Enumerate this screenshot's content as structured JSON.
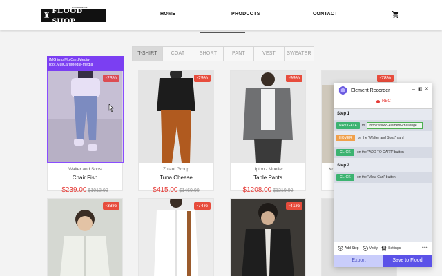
{
  "header": {
    "logo_tag": "ecommerce",
    "logo_text": "FLOOD SHOP",
    "nav": [
      "HOME",
      "PRODUCTS",
      "CONTACT"
    ],
    "cart_icon": "cart-icon"
  },
  "filters": {
    "tabs": [
      "T-SHIRT",
      "COAT",
      "SHORT",
      "PANT",
      "VEST",
      "SWEATER"
    ],
    "active": "T-SHIRT"
  },
  "overlay": {
    "label": "IMG img.MuiCardMedia-root.MuiCardMedia-media"
  },
  "products": [
    {
      "badge": "-23%",
      "vendor": "Walter and Sons",
      "title": "Chair Fish",
      "price": "$239.00",
      "old_price": "$1018.00"
    },
    {
      "badge": "-29%",
      "vendor": "Zulauf Group",
      "title": "Tuna Cheese",
      "price": "$415.00",
      "old_price": "$1460.00"
    },
    {
      "badge": "-99%",
      "vendor": "Upton - Mueller",
      "title": "Table Pants",
      "price": "$1208.00",
      "old_price": "$1219.00"
    },
    {
      "badge": "-78%",
      "vendor": "Ko",
      "title": "",
      "price": "",
      "old_price": ""
    },
    {
      "badge": "-33%"
    },
    {
      "badge": "-74%"
    },
    {
      "badge": "-41%"
    },
    {
      "badge": ""
    }
  ],
  "recorder": {
    "title": "Element Recorder",
    "controls": [
      "_",
      "◧",
      "✕"
    ],
    "status": "REC",
    "steps": [
      {
        "label": "Step 1",
        "actions": [
          {
            "action": "NAVIGATE",
            "prefix": "to",
            "url": "https://flood-element-challenge..."
          },
          {
            "action": "HOVER",
            "text": "on the \"Walter and Sons\" card"
          },
          {
            "action": "CLICK",
            "text": "on the \"ADD TO CART\" button"
          }
        ]
      },
      {
        "label": "Step 2",
        "actions": [
          {
            "action": "CLICK",
            "text": "on the \"View Cart\" button"
          }
        ]
      }
    ],
    "tools": [
      "Add Step",
      "Verify",
      "Settings"
    ],
    "more": "•••",
    "export_label": "Export",
    "save_label": "Save to Flood"
  },
  "colors": {
    "accent": "#5b52e8",
    "sale_red": "#e53935",
    "highlight_purple": "#7b3ff2",
    "action_green": "#3cb371",
    "action_orange": "#f0a04b"
  }
}
